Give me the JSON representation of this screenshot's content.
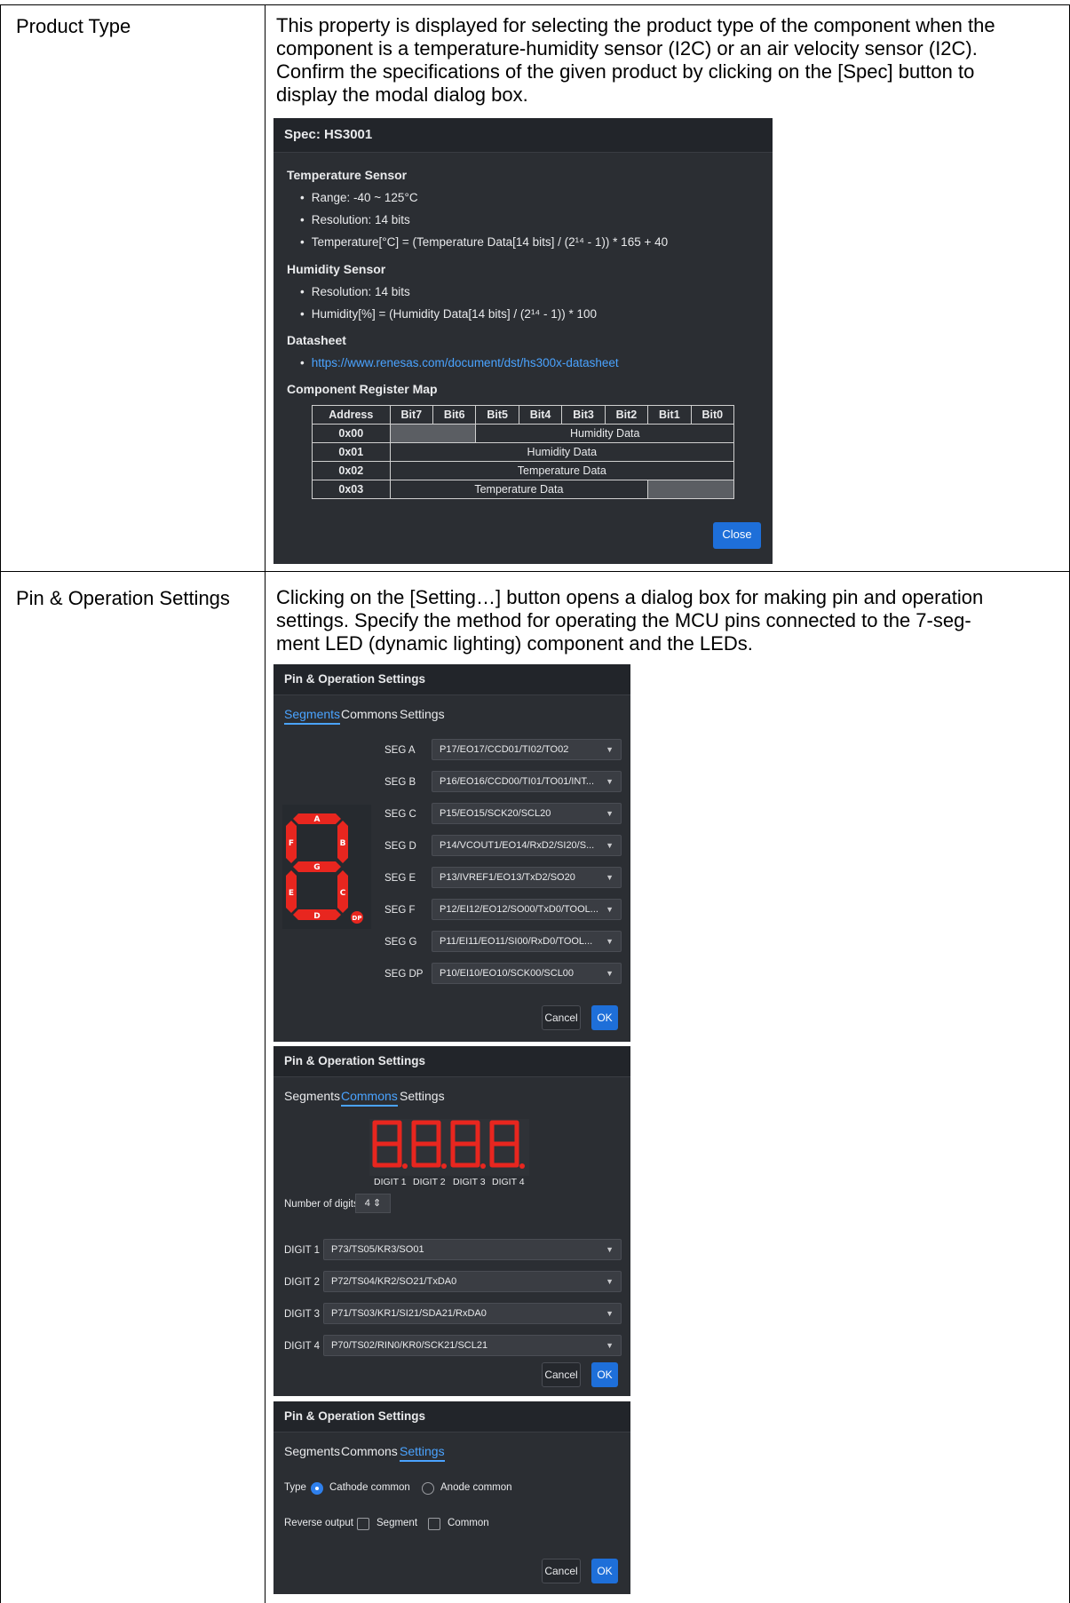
{
  "rows": [
    {
      "label": "Product Type",
      "text_lines": [
        "This property is displayed for selecting the product type of the component when the",
        "component is a temperature-humidity sensor (I2C) or an air velocity sensor (I2C).",
        "Confirm the specifications of the given product by clicking on the [Spec] button to",
        "display the modal dialog box."
      ]
    },
    {
      "label": "Pin & Operation Settings",
      "text_lines": [
        "Clicking on the [Setting…] button opens a dialog box for making pin and operation",
        "settings. Specify the method for operating the MCU pins connected to the 7-seg-",
        "ment LED (dynamic lighting) component and the LEDs."
      ]
    }
  ],
  "spec_dialog": {
    "title": "Spec: HS3001",
    "temp_heading": "Temperature Sensor",
    "temp_bullets": [
      "Range: -40 ~ 125°C",
      "Resolution: 14 bits",
      "Temperature[°C] = (Temperature Data[14 bits] / (2¹⁴ - 1)) * 165 + 40"
    ],
    "hum_heading": "Humidity Sensor",
    "hum_bullets": [
      "Resolution: 14 bits",
      "Humidity[%] = (Humidity Data[14 bits] / (2¹⁴ - 1)) * 100"
    ],
    "datasheet_heading": "Datasheet",
    "datasheet_link": "https://www.renesas.com/document/dst/hs300x-datasheet",
    "regmap_heading": "Component Register Map",
    "reg_headers": [
      "Address",
      "Bit7",
      "Bit6",
      "Bit5",
      "Bit4",
      "Bit3",
      "Bit2",
      "Bit1",
      "Bit0"
    ],
    "reg_rows": [
      {
        "addr": "0x00",
        "text": "Humidity Data"
      },
      {
        "addr": "0x01",
        "text": "Humidity Data"
      },
      {
        "addr": "0x02",
        "text": "Temperature Data"
      },
      {
        "addr": "0x03",
        "text": "Temperature Data"
      }
    ],
    "close_label": "Close"
  },
  "pin_dialog_title": "Pin & Operation Settings",
  "tabs": [
    "Segments",
    "Commons",
    "Settings"
  ],
  "segments_dialog": {
    "segment_letters": [
      "A",
      "B",
      "C",
      "D",
      "E",
      "F",
      "G",
      "DP"
    ],
    "rows": [
      {
        "label": "SEG A",
        "value": "P17/EO17/CCD01/TI02/TO02"
      },
      {
        "label": "SEG B",
        "value": "P16/EO16/CCD00/TI01/TO01/INT..."
      },
      {
        "label": "SEG C",
        "value": "P15/EO15/SCK20/SCL20"
      },
      {
        "label": "SEG D",
        "value": "P14/VCOUT1/EO14/RxD2/SI20/S..."
      },
      {
        "label": "SEG E",
        "value": "P13/IVREF1/EO13/TxD2/SO20"
      },
      {
        "label": "SEG F",
        "value": "P12/EI12/EO12/SO00/TxD0/TOOL..."
      },
      {
        "label": "SEG G",
        "value": "P11/EI11/EO11/SI00/RxD0/TOOL..."
      },
      {
        "label": "SEG DP",
        "value": "P10/EI10/EO10/SCK00/SCL00"
      }
    ]
  },
  "commons_dialog": {
    "digit_captions": [
      "DIGIT 1",
      "DIGIT 2",
      "DIGIT 3",
      "DIGIT 4"
    ],
    "num_digits_label": "Number of digits",
    "num_digits_value": "4",
    "rows": [
      {
        "label": "DIGIT 1",
        "value": "P73/TS05/KR3/SO01"
      },
      {
        "label": "DIGIT 2",
        "value": "P72/TS04/KR2/SO21/TxDA0"
      },
      {
        "label": "DIGIT 3",
        "value": "P71/TS03/KR1/SI21/SDA21/RxDA0"
      },
      {
        "label": "DIGIT 4",
        "value": "P70/TS02/RIN0/KR0/SCK21/SCL21"
      }
    ]
  },
  "settings_dialog": {
    "type_label": "Type",
    "cathode_label": "Cathode common",
    "anode_label": "Anode common",
    "reverse_label": "Reverse output",
    "segment_label": "Segment",
    "common_label": "Common"
  },
  "cancel_label": "Cancel",
  "ok_label": "OK",
  "colors": {
    "led_red": "#e8261f",
    "accent": "#2f80ed",
    "dialog_bg": "#2b2e33"
  }
}
